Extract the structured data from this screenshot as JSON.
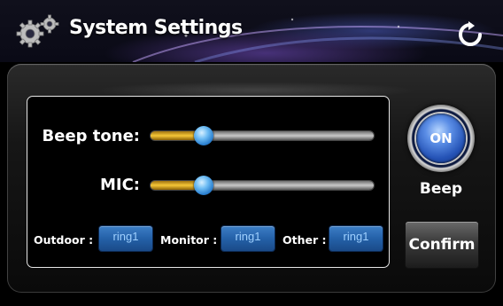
{
  "header": {
    "title": "System Settings",
    "gear_icon": "gears-icon",
    "refresh_icon": "refresh-icon"
  },
  "sliders": [
    {
      "label": "Beep tone:",
      "level": 0.2
    },
    {
      "label": "MIC:",
      "level": 0.2
    }
  ],
  "rings": [
    {
      "label": "Outdoor :",
      "value": "ring1"
    },
    {
      "label": "Monitor :",
      "value": "ring1"
    },
    {
      "label": "Other :",
      "value": "ring1"
    }
  ],
  "beep": {
    "state": "ON",
    "label": "Beep"
  },
  "confirm_label": "Confirm",
  "colors": {
    "accent_blue": "#2461a8",
    "slider_fill": "#f6c738",
    "background": "#000000"
  }
}
